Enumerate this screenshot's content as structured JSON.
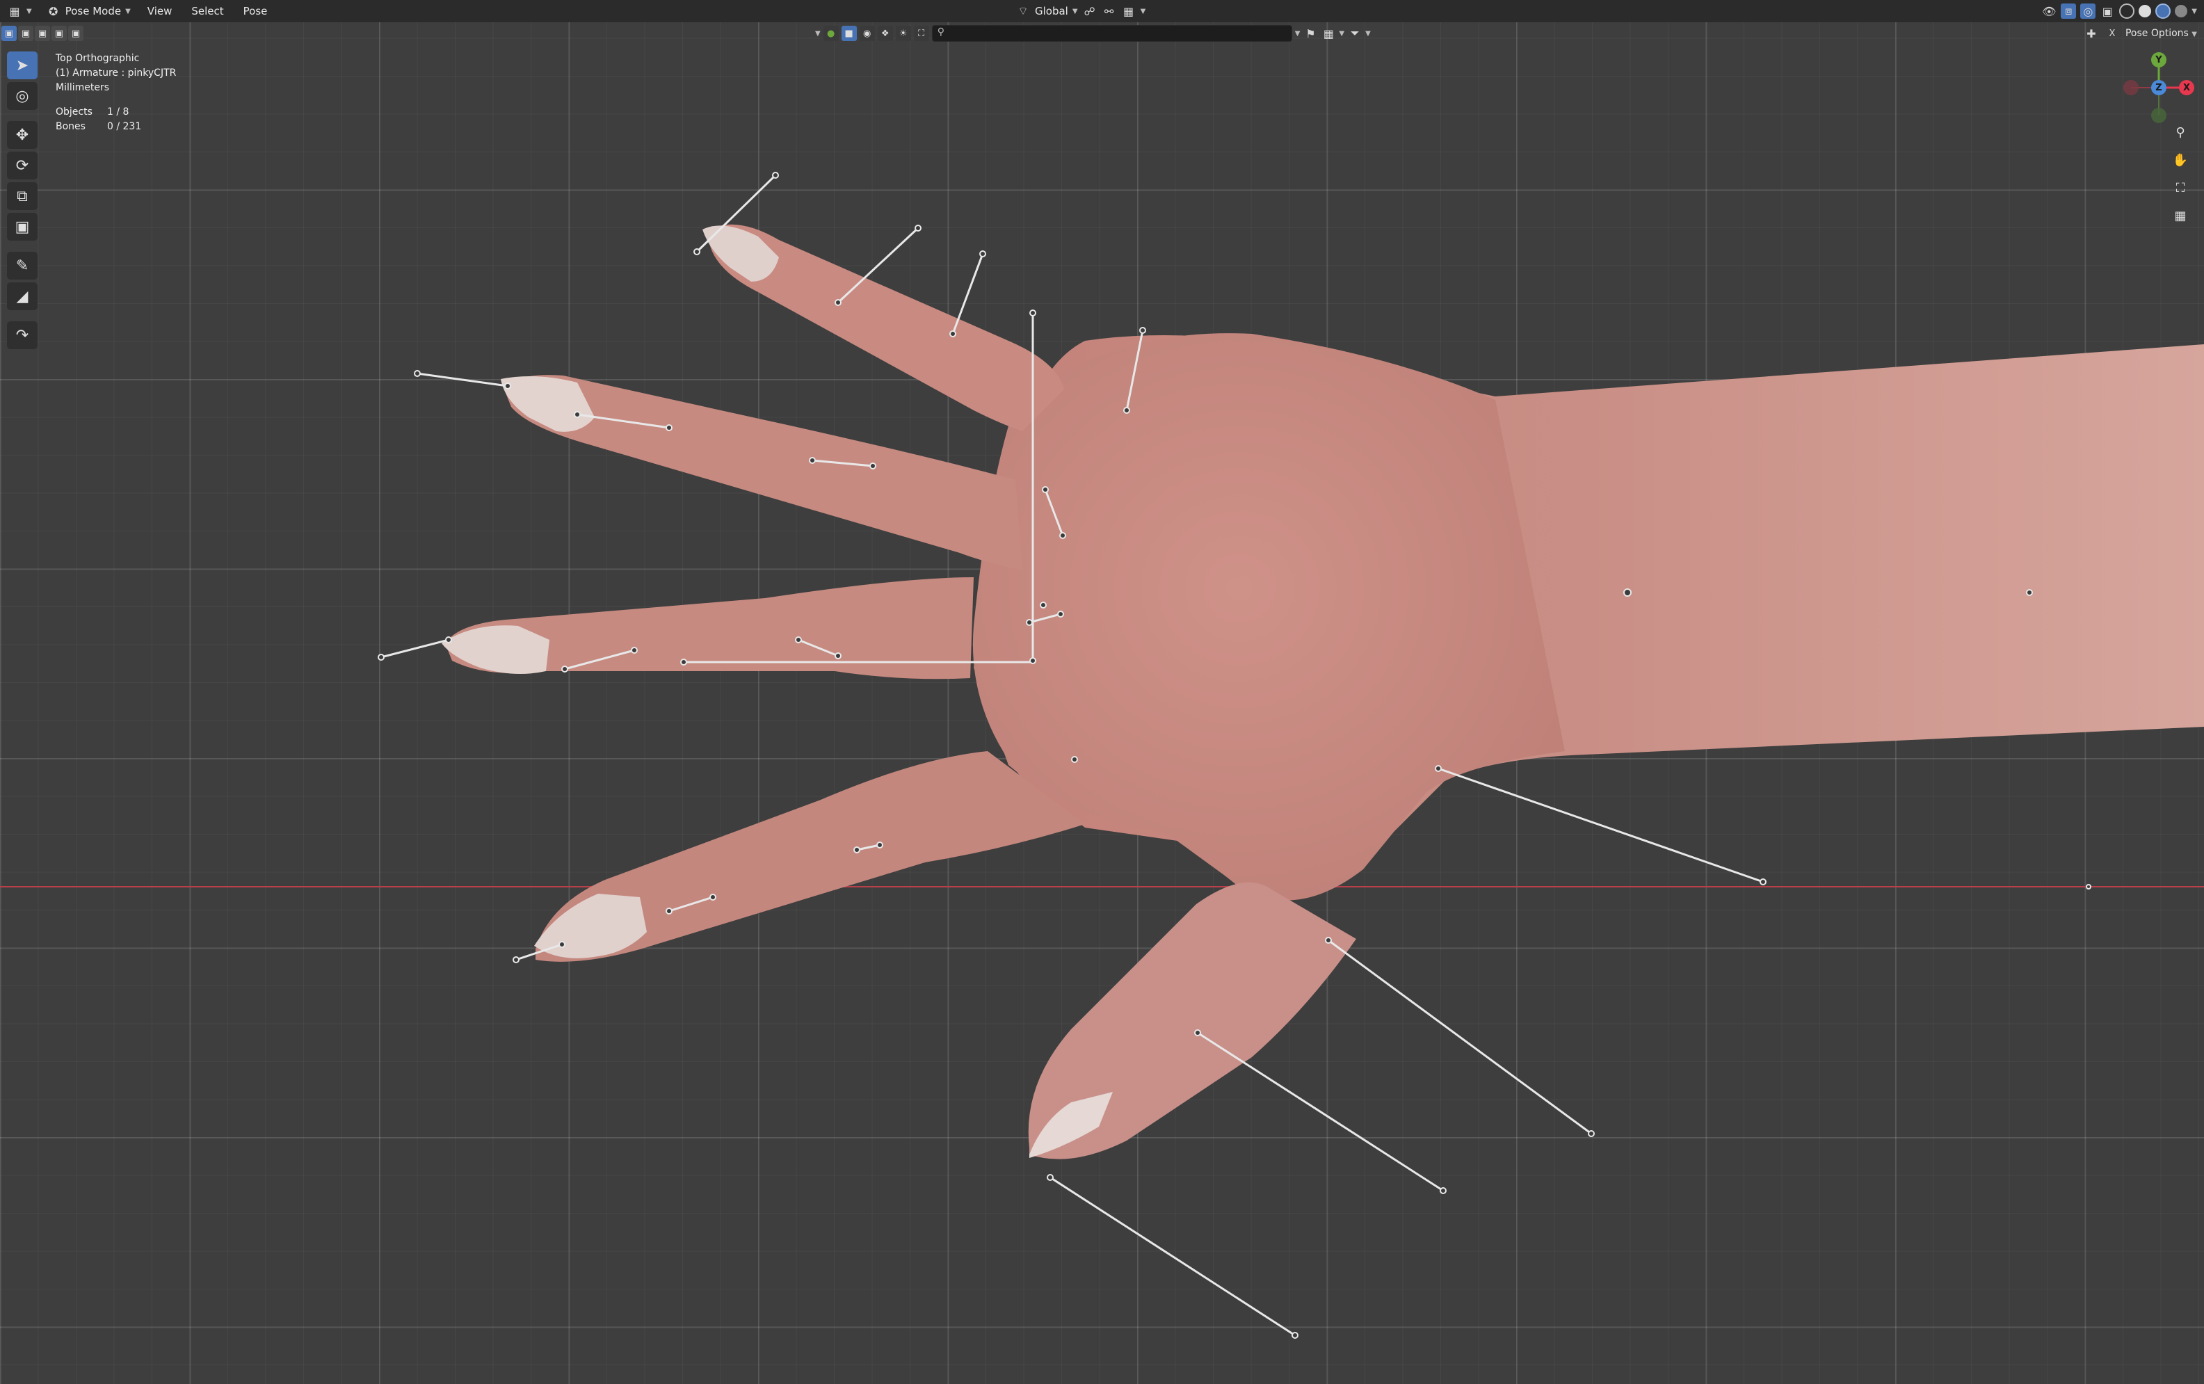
{
  "header": {
    "mode_label": "Pose Mode",
    "menus": [
      "View",
      "Select",
      "Pose"
    ],
    "transform_orientation": "Global"
  },
  "toolrow": {
    "search_placeholder": "",
    "pose_options_label": "Pose Options"
  },
  "overlay": {
    "view_name": "Top Orthographic",
    "object_info": "(1) Armature : pinkyCJTR",
    "units": "Millimeters",
    "objects_label": "Objects",
    "objects_value": "1 / 8",
    "bones_label": "Bones",
    "bones_value": "0 / 231"
  },
  "gizmo": {
    "x_label": "X",
    "y_label": "Y",
    "z_label": "Z",
    "x_color": "#e8384f",
    "y_color": "#6ca83c",
    "z_color": "#4a8ad8"
  },
  "toolbar": {
    "tools": [
      "select-box-icon",
      "cursor-icon",
      "move-icon",
      "rotate-icon",
      "scale-icon",
      "transform-icon",
      "annotate-icon",
      "measure-icon",
      "relax-pose-icon"
    ]
  },
  "colors": {
    "active_blue": "#4772b3",
    "grid_bg": "#3e3e3e",
    "skin": "#c98f86",
    "x_axis_line": "#b8404a"
  }
}
